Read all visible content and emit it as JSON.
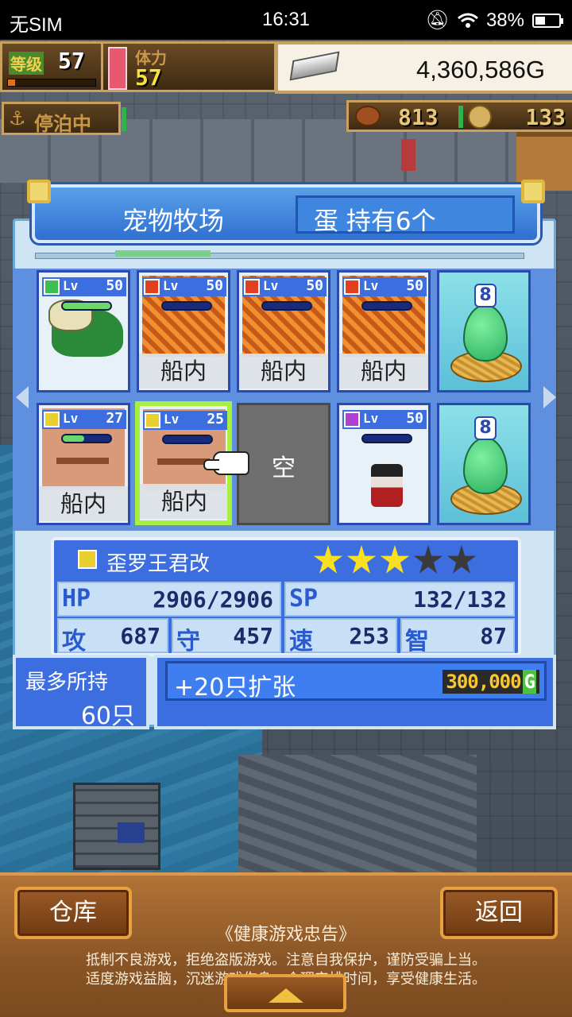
{
  "status_bar": {
    "carrier": "无SIM",
    "time": "16:31",
    "battery": "38%"
  },
  "hud": {
    "level_label": "等级",
    "level": "57",
    "level_exp_fraction": 0.08,
    "stamina_label": "体力",
    "stamina": "57",
    "money": "4,360,586G",
    "dock_status": "停泊中",
    "resource1": "813",
    "resource2": "133"
  },
  "panel": {
    "title": "宠物牧场",
    "eggs_owned": "蛋 持有6个"
  },
  "pets": [
    {
      "element": "green",
      "level_label": "Lv",
      "level": "50",
      "hp_fraction": 1.0,
      "location": "",
      "art": "dragon"
    },
    {
      "element": "red",
      "level_label": "Lv",
      "level": "50",
      "hp_fraction": 0.0,
      "location": "船内",
      "art": "fire"
    },
    {
      "element": "red",
      "level_label": "Lv",
      "level": "50",
      "hp_fraction": 0.0,
      "location": "船内",
      "art": "fire"
    },
    {
      "element": "red",
      "level_label": "Lv",
      "level": "50",
      "hp_fraction": 0.0,
      "location": "船内",
      "art": "fire"
    },
    {
      "egg_count": "8"
    },
    {
      "element": "yellow",
      "level_label": "Lv",
      "level": "27",
      "hp_fraction": 0.45,
      "location": "船内",
      "art": "face"
    },
    {
      "element": "yellow",
      "level_label": "Lv",
      "level": "25",
      "hp_fraction": 0.0,
      "location": "船内",
      "art": "face",
      "selected": true
    },
    {
      "empty_label": "空"
    },
    {
      "element": "purple",
      "level_label": "Lv",
      "level": "50",
      "hp_fraction": 0.0,
      "location": "",
      "art": "pirate"
    },
    {
      "egg_count": "8"
    }
  ],
  "detail": {
    "name": "歪罗王君改",
    "stars": 3,
    "max_stars": 5,
    "hp_label": "HP",
    "hp": "2906/2906",
    "sp_label": "SP",
    "sp": "132/132",
    "atk_label": "攻",
    "atk": "687",
    "def_label": "守",
    "def": "457",
    "spd_label": "速",
    "spd": "253",
    "int_label": "智",
    "int": "87"
  },
  "capacity": {
    "label": "最多所持",
    "value": "60只"
  },
  "expand": {
    "label": "+20只扩张",
    "price": "300,000",
    "currency": "G"
  },
  "bottom": {
    "storage_button": "仓库",
    "back_button": "返回",
    "notice_title": "《健康游戏忠告》",
    "notice_line1": "抵制不良游戏，拒绝盗版游戏。注意自我保护，谨防受骗上当。",
    "notice_line2": "适度游戏益脑，沉迷游戏伤身。合理安排时间，享受健康生活。"
  },
  "colors": {
    "panel_blue": "#3c6ee0",
    "selected_border": "#a8f040",
    "star_on": "#f8e020"
  }
}
